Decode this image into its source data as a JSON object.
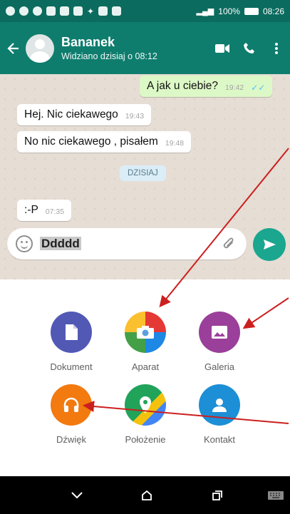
{
  "status_bar": {
    "battery_text": "100%",
    "time": "08:26"
  },
  "header": {
    "contact_name": "Bananek",
    "contact_status": "Widziano dzisiaj o 08:12",
    "icons": [
      "back-arrow-icon",
      "video-call-icon",
      "phone-icon",
      "more-vert-icon"
    ]
  },
  "chat": {
    "messages": [
      {
        "text": "A jak u ciebie?",
        "time": "19:42",
        "outgoing": true
      },
      {
        "text": "Hej. Nic ciekawego",
        "time": "19:43",
        "outgoing": false
      },
      {
        "text": "No nic ciekawego , pisałem",
        "time": "19:48",
        "outgoing": false
      },
      {
        "text": ":-P",
        "time": "07:35",
        "outgoing": false
      }
    ],
    "day_chip": "DZISIAJ"
  },
  "input": {
    "value": "Ddddd"
  },
  "attachments": [
    {
      "label": "Dokument",
      "icon": "document-icon",
      "color": "#5159b5"
    },
    {
      "label": "Aparat",
      "icon": "camera-icon",
      "color": "#f4a91f"
    },
    {
      "label": "Galeria",
      "icon": "gallery-icon",
      "color": "#9a3f9a"
    },
    {
      "label": "Dźwięk",
      "icon": "headphones-icon",
      "color": "#f27a0f"
    },
    {
      "label": "Położenie",
      "icon": "location-icon",
      "color": "#21a35a"
    },
    {
      "label": "Kontakt",
      "icon": "contact-icon",
      "color": "#1c8fd6"
    }
  ],
  "navbar": {
    "icons": [
      "back-chevron-icon",
      "home-icon",
      "recents-icon",
      "keyboard-icon"
    ]
  },
  "colors": {
    "header": "#0e7d6e",
    "status_bar": "#0b6b5e",
    "send_button": "#1aa68f",
    "annotation_arrow": "#cc1f1f"
  }
}
